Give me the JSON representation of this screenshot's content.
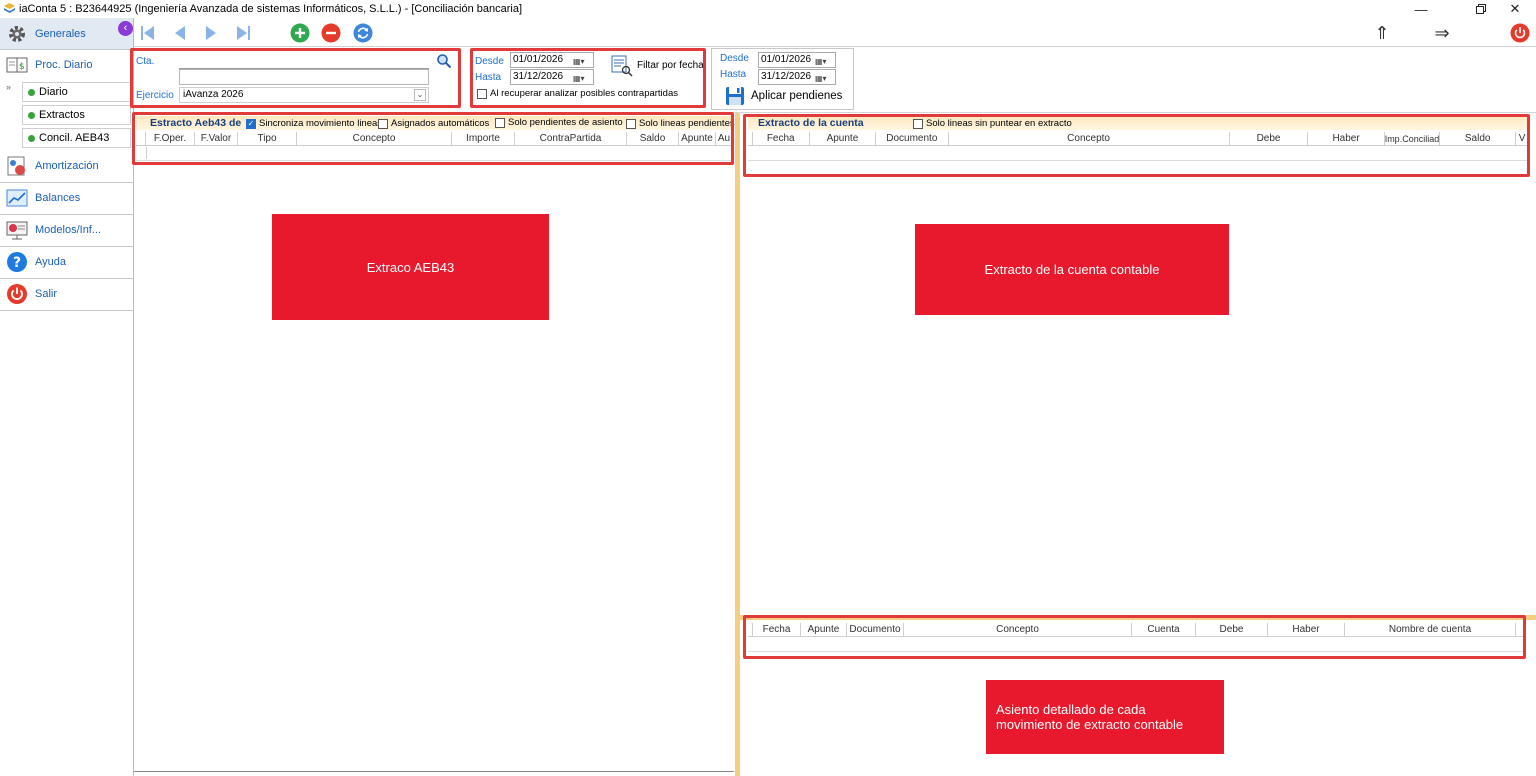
{
  "window": {
    "title": "iaConta 5 : B23644925 (Ingeniería Avanzada de sistemas Informáticos, S.L.L.) - [Conciliación bancaria]",
    "controls": [
      "minimize-icon",
      "restore-icon",
      "close-icon"
    ]
  },
  "sidebar": {
    "items": [
      {
        "label": "Generales",
        "icon": "gear-icon"
      },
      {
        "label": "Proc. Diario",
        "icon": "ledger-icon"
      },
      {
        "label": "Amortización",
        "icon": "amortization-icon"
      },
      {
        "label": "Balances",
        "icon": "chart-icon"
      },
      {
        "label": "Modelos/Inf...",
        "icon": "report-icon"
      },
      {
        "label": "Ayuda",
        "icon": "help-icon"
      },
      {
        "label": "Salir",
        "icon": "power-icon"
      }
    ],
    "subitems": [
      {
        "label": "Diario"
      },
      {
        "label": "Extractos"
      },
      {
        "label": "Concil. AEB43"
      }
    ]
  },
  "toolbar": {
    "icons": [
      "first-icon",
      "prev-icon",
      "next-icon",
      "last-icon",
      "add-icon",
      "remove-icon",
      "refresh-icon"
    ],
    "right_icons": [
      "arrow-up-icon",
      "arrow-right-icon",
      "power-icon"
    ],
    "arrow_up_glyph": "⇑",
    "arrow_right_glyph": "⇒"
  },
  "filters": {
    "cta_label": "Cta.",
    "cta_value": "",
    "cta_name": "",
    "ejercicio_label": "Ejercicio",
    "ejercicio_value": "iAvanza 2026",
    "desde_label": "Desde",
    "hasta_label": "Hasta",
    "desde_value": "01/01/2026",
    "hasta_value": "31/12/2026",
    "filtrar_label": "Filtar por fecha",
    "analizar_label": "Al recuperar analizar posibles contrapartidas",
    "pend_desde_label": "Desde",
    "pend_hasta_label": "Hasta",
    "pend_desde_value": "01/01/2026",
    "pend_hasta_value": "31/12/2026",
    "aplicar_label": "Aplicar pendienes"
  },
  "left_grid": {
    "title": "Estracto Aeb43 de",
    "options": [
      {
        "label": "Sincroniza movimiento lineas",
        "checked": true
      },
      {
        "label": "Asignados automáticos",
        "checked": false
      },
      {
        "label": "Solo pendientes de asiento",
        "checked": false
      },
      {
        "label": "Solo lineas pendientes",
        "checked": false
      }
    ],
    "columns": [
      "F.Oper.",
      "F.Valor",
      "Tipo",
      "Concepto",
      "Importe",
      "ContraPartida",
      "Saldo",
      "Apunte",
      "Au"
    ]
  },
  "right_grid": {
    "title": "Extracto de la cuenta",
    "option": {
      "label": "Solo lineas sin puntear en extracto",
      "checked": false
    },
    "columns": [
      "Fecha",
      "Apunte",
      "Documento",
      "Concepto",
      "Debe",
      "Haber",
      "Imp.Conciliado",
      "Saldo",
      "V"
    ]
  },
  "detail_grid": {
    "columns": [
      "Fecha",
      "Apunte",
      "Documento",
      "Concepto",
      "Cuenta",
      "Debe",
      "Haber",
      "Nombre de cuenta"
    ]
  },
  "callouts": {
    "aeb43": "Extraco AEB43",
    "cuenta": "Extracto de la cuenta contable",
    "asiento": "Asiento detallado de cada movimiento de extracto contable"
  },
  "colors": {
    "accent_blue": "#1f6fd0",
    "highlight_red": "#e03a3a",
    "callout_red": "#e8192c",
    "splitter": "#f4cf83"
  }
}
